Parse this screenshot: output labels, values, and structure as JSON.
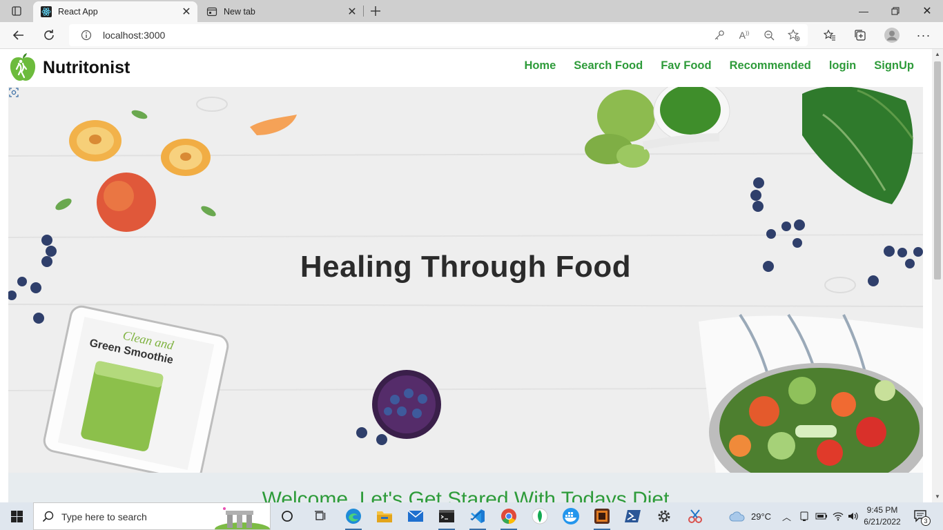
{
  "browser": {
    "tabs": [
      {
        "title": "React App",
        "active": true
      },
      {
        "title": "New tab",
        "active": false
      }
    ],
    "url": "localhost:3000"
  },
  "site": {
    "brand": "Nutritonist",
    "nav": [
      "Home",
      "Search Food",
      "Fav Food",
      "Recommended",
      "login",
      "SignUp"
    ],
    "hero_title": "Healing Through Food",
    "tablet_text_1": "Clean and",
    "tablet_text_2": "Green Smoothie",
    "welcome": "Welcome, Let's Get Stared With Todays Diet"
  },
  "taskbar": {
    "search_placeholder": "Type here to search",
    "weather": "29°C",
    "time": "9:45 PM",
    "date": "6/21/2022",
    "notifications": "3"
  },
  "colors": {
    "accent_green": "#2e9b3a",
    "hero_bg": "#ececec",
    "taskbar_bg": "#dfe6ee"
  }
}
